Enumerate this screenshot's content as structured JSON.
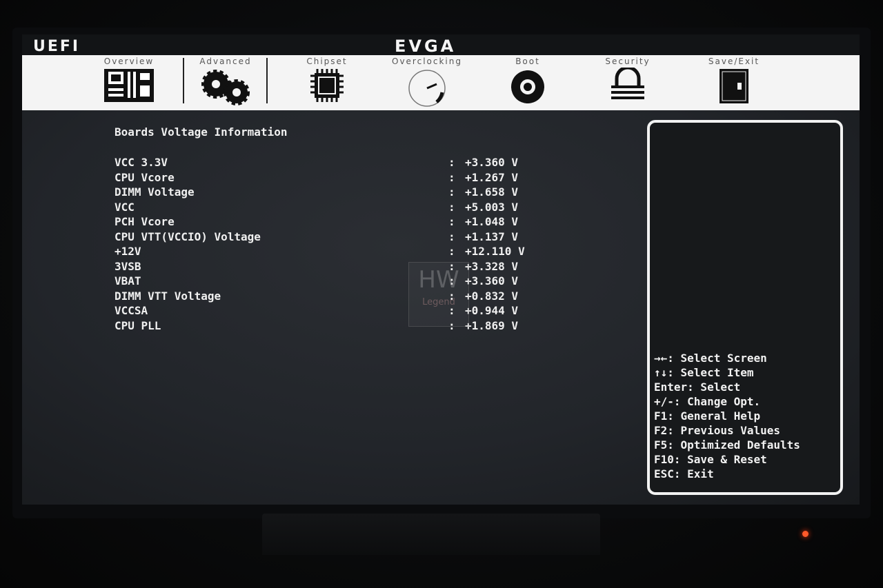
{
  "header": {
    "left_logo": "UEFI",
    "center_logo": "EVGA"
  },
  "tabs": [
    {
      "label": "Overview",
      "icon": "motherboard-icon"
    },
    {
      "label": "Advanced",
      "icon": "gears-icon"
    },
    {
      "label": "Chipset",
      "icon": "chip-icon"
    },
    {
      "label": "Overclocking",
      "icon": "gauge-icon"
    },
    {
      "label": "Boot",
      "icon": "disc-icon"
    },
    {
      "label": "Security",
      "icon": "lock-icon"
    },
    {
      "label": "Save/Exit",
      "icon": "door-icon"
    }
  ],
  "main": {
    "section_title": "Boards Voltage Information",
    "separator": ":",
    "rows": [
      {
        "label": "VCC 3.3V",
        "value": "+3.360 V"
      },
      {
        "label": "CPU Vcore",
        "value": "+1.267 V"
      },
      {
        "label": "DIMM Voltage",
        "value": "+1.658 V"
      },
      {
        "label": "VCC",
        "value": "+5.003 V"
      },
      {
        "label": "PCH Vcore",
        "value": "+1.048 V"
      },
      {
        "label": "CPU VTT(VCCIO) Voltage",
        "value": "+1.137 V"
      },
      {
        "label": "+12V",
        "value": "+12.110 V"
      },
      {
        "label": "3VSB",
        "value": "+3.328 V"
      },
      {
        "label": "VBAT",
        "value": "+3.360 V"
      },
      {
        "label": "DIMM VTT Voltage",
        "value": "+0.832 V"
      },
      {
        "label": "VCCSA",
        "value": "+0.944 V"
      },
      {
        "label": "CPU PLL",
        "value": "+1.869 V"
      }
    ]
  },
  "watermark": {
    "main": "HW",
    "sub": "Legend"
  },
  "help": {
    "lines": [
      "→←: Select Screen",
      "↑↓: Select Item",
      "Enter: Select",
      "+/-: Change Opt.",
      "F1: General Help",
      "F2: Previous Values",
      "F5: Optimized Defaults",
      "F10: Save & Reset",
      "ESC: Exit"
    ]
  },
  "colors": {
    "screen_bg": "#23262b",
    "text": "#f0f0f0",
    "tab_bar": "#f4f4f4",
    "power_led": "#ff5a2a"
  }
}
